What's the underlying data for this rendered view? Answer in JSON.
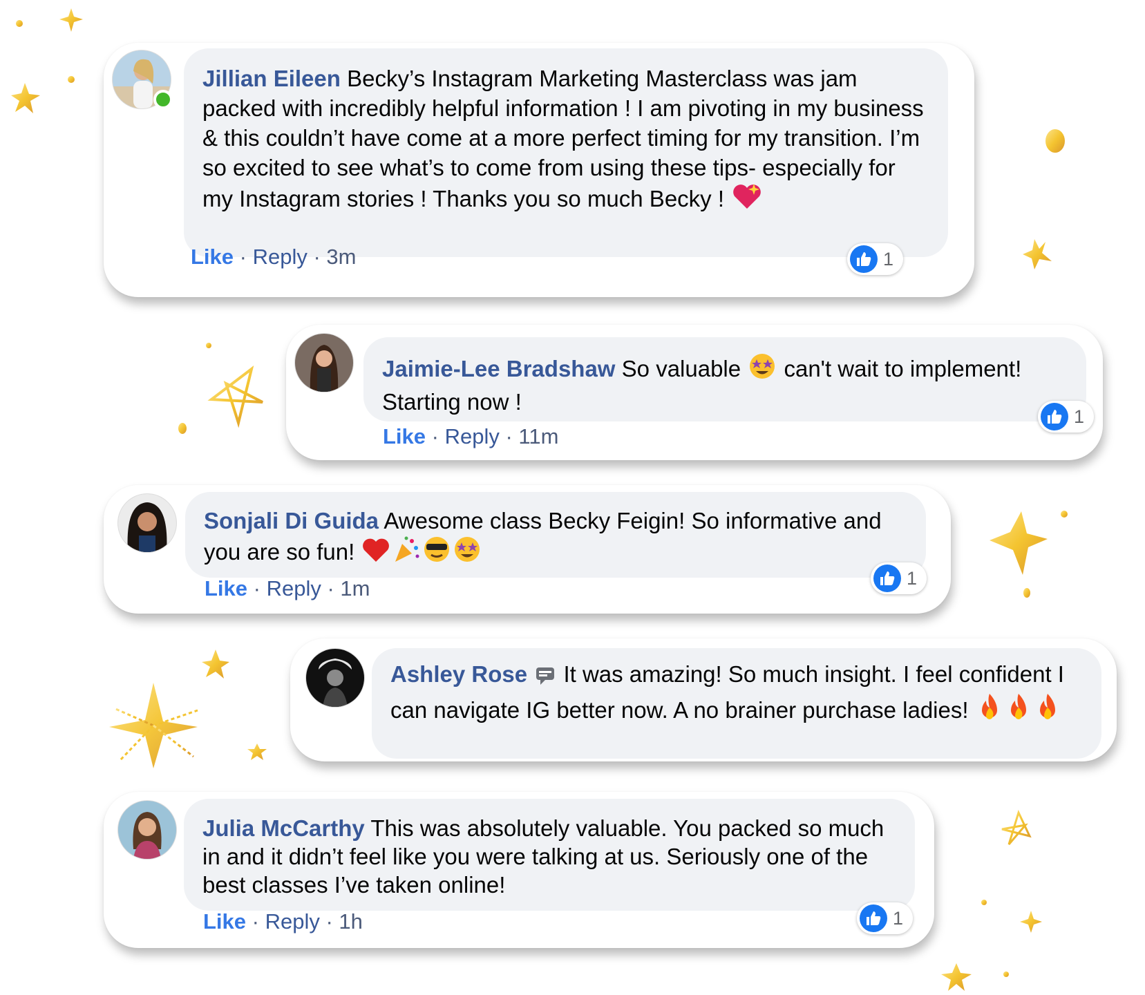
{
  "theme": {
    "link_color": "#385898",
    "like_color": "#3578e5",
    "bubble_bg": "#f0f2f5",
    "reaction_color": "#1877f2",
    "star_color": "#f4c430"
  },
  "comments": [
    {
      "author": "Jillian Eileen",
      "text": "Becky’s Instagram Marketing Masterclass was jam packed with incredibly helpful information ! I am pivoting in my business & this couldn’t have come at a more perfect timing for my transition. I’m so excited to see what’s to come from using these tips- especially for my Instagram stories ! Thanks you so much Becky !",
      "emojis": [
        "sparkling-heart-icon"
      ],
      "like_label": "Like",
      "reply_label": "Reply",
      "time": "3m",
      "reactions": "1",
      "online": true
    },
    {
      "author": "Jaimie-Lee Bradshaw",
      "text_before": "So valuable",
      "text_after": "can't wait to implement! Starting now !",
      "emojis": [
        "star-struck-icon"
      ],
      "like_label": "Like",
      "reply_label": "Reply",
      "time": "11m",
      "reactions": "1"
    },
    {
      "author": "Sonjali Di Guida",
      "text": "Awesome class Becky Feigin! So informative and you are so fun!",
      "emojis": [
        "red-heart-icon",
        "party-popper-icon",
        "sunglasses-face-icon",
        "star-struck-icon"
      ],
      "like_label": "Like",
      "reply_label": "Reply",
      "time": "1m",
      "reactions": "1"
    },
    {
      "author": "Ashley Rose",
      "text": "It was amazing! So much insight. I feel confident I can navigate IG better now. A no brainer purchase ladies!",
      "emojis": [
        "speech-bubble-icon",
        "fire-icon",
        "fire-icon",
        "fire-icon"
      ]
    },
    {
      "author": "Julia McCarthy",
      "text": "This was absolutely valuable. You packed so much in and it didn’t feel like you were talking at us. Seriously one of the best classes I’ve taken online!",
      "like_label": "Like",
      "reply_label": "Reply",
      "time": "1h",
      "reactions": "1"
    }
  ]
}
